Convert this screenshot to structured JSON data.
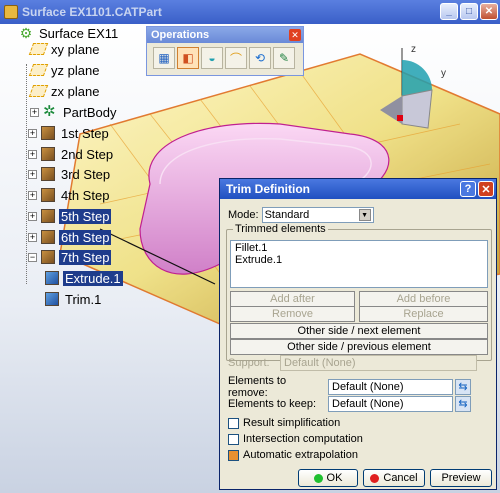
{
  "window": {
    "title": "Surface EX1101.CATPart",
    "min": "_",
    "max": "□",
    "close": "✕"
  },
  "tree": {
    "root": "Surface EX11",
    "items": [
      {
        "label": "xy plane",
        "type": "plane",
        "selected": false
      },
      {
        "label": "yz plane",
        "type": "plane",
        "selected": false
      },
      {
        "label": "zx plane",
        "type": "plane",
        "selected": false
      },
      {
        "label": "PartBody",
        "type": "body",
        "selected": false
      },
      {
        "label": "1st Step",
        "type": "step",
        "selected": false
      },
      {
        "label": "2nd Step",
        "type": "step",
        "selected": false
      },
      {
        "label": "3rd Step",
        "type": "step",
        "selected": false
      },
      {
        "label": "4th Step",
        "type": "step",
        "selected": false
      },
      {
        "label": "5th Step",
        "type": "step",
        "selected": true
      },
      {
        "label": "6th Step",
        "type": "step",
        "selected": true
      },
      {
        "label": "7th Step",
        "type": "step",
        "selected": true
      },
      {
        "label": "Extrude.1",
        "type": "feature",
        "selected": true
      },
      {
        "label": "Trim.1",
        "type": "feature",
        "selected": false
      }
    ]
  },
  "operations": {
    "title": "Operations",
    "close": "✕",
    "tools": [
      "join-icon",
      "trim-icon",
      "split-icon",
      "fillet-icon",
      "transform-icon",
      "extrapolate-icon"
    ]
  },
  "axis": {
    "z": "z",
    "y": "y"
  },
  "dialog": {
    "title": "Trim Definition",
    "help": "?",
    "close": "✕",
    "mode_label": "Mode:",
    "mode_value": "Standard",
    "trimmed_legend": "Trimmed elements",
    "trimmed_list": [
      "Fillet.1",
      "Extrude.1"
    ],
    "add_after": "Add after",
    "add_before": "Add before",
    "remove": "Remove",
    "replace": "Replace",
    "other_side_next": "Other side / next element",
    "other_side_prev": "Other side / previous element",
    "support_label": "Support:",
    "support_value": "Default (None)",
    "remove_label": "Elements to remove:",
    "remove_value": "Default (None)",
    "keep_label": "Elements to keep:",
    "keep_value": "Default (None)",
    "result_simplification": "Result simplification",
    "intersection_computation": "Intersection computation",
    "automatic_extrapolation": "Automatic extrapolation",
    "ok": "OK",
    "cancel": "Cancel",
    "preview": "Preview"
  },
  "colors": {
    "selection": "#1e3c8c",
    "surface": "#f7f0a0",
    "solid": "#e8a8e0",
    "accent": "#e89030"
  }
}
